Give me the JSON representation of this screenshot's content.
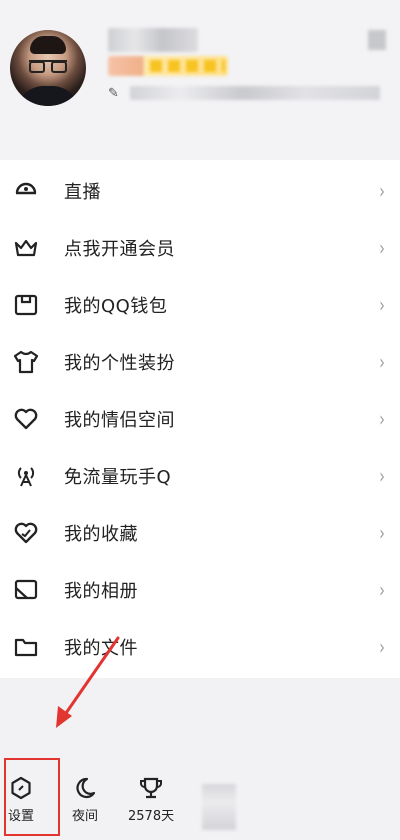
{
  "menu": {
    "items": [
      {
        "label": "直播",
        "icon": "live-icon"
      },
      {
        "label": "点我开通会员",
        "icon": "crown-icon"
      },
      {
        "label": "我的QQ钱包",
        "icon": "wallet-icon"
      },
      {
        "label": "我的个性装扮",
        "icon": "tshirt-icon"
      },
      {
        "label": "我的情侣空间",
        "icon": "heart-icon"
      },
      {
        "label": "免流量玩手Q",
        "icon": "antenna-icon"
      },
      {
        "label": "我的收藏",
        "icon": "favorite-icon"
      },
      {
        "label": "我的相册",
        "icon": "album-icon"
      },
      {
        "label": "我的文件",
        "icon": "folder-icon"
      }
    ],
    "chevron": "›"
  },
  "bottom_bar": {
    "settings_label": "设置",
    "night_label": "夜间",
    "days_label": "2578天"
  },
  "colors": {
    "highlight": "#e23530",
    "menu_background": "#ffffff",
    "page_background": "#f2f2f4"
  }
}
